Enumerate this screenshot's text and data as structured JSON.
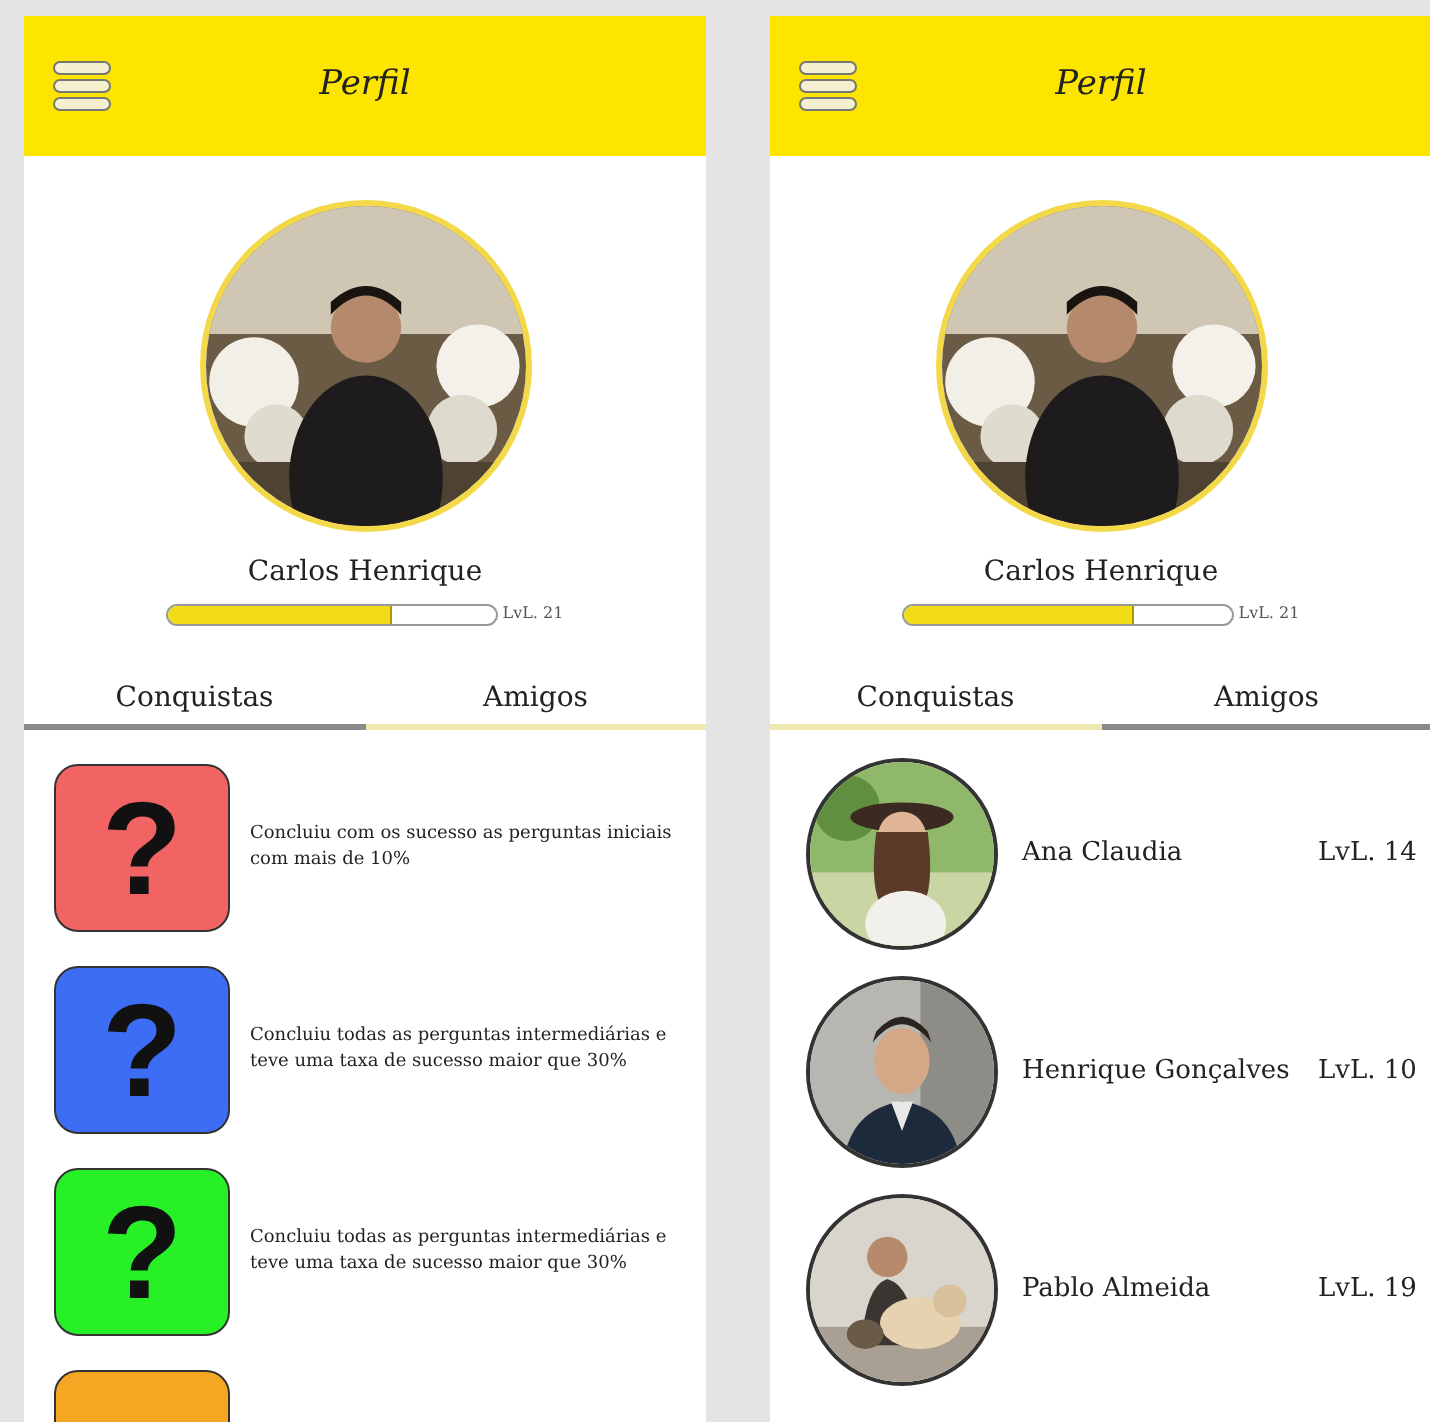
{
  "screens": [
    {
      "header": {
        "title": "Perfil"
      },
      "profile": {
        "name": "Carlos Henrique",
        "level": 0.68,
        "level_label": "LvL. 21"
      },
      "tabs": [
        {
          "label": "Conquistas",
          "selected": true
        },
        {
          "label": "Amigos",
          "selected": false
        }
      ],
      "achievements": [
        {
          "symbol": "?",
          "color": "#f26363",
          "description": "Concluiu com os sucesso as perguntas iniciais com mais de 10%"
        },
        {
          "symbol": "?",
          "color": "#3d6cf5",
          "description": "Concluiu todas as perguntas intermediárias e teve uma taxa de sucesso maior que 30%"
        },
        {
          "symbol": "?",
          "color": "#27f027",
          "description": "Concluiu todas as perguntas intermediárias e teve uma taxa de sucesso maior que 30%"
        },
        {
          "color": "#f5a623"
        }
      ]
    },
    {
      "header": {
        "title": "Perfil"
      },
      "profile": {
        "name": "Carlos Henrique",
        "level": 0.7,
        "level_label": "LvL. 21"
      },
      "tabs": [
        {
          "label": "Conquistas",
          "selected": false
        },
        {
          "label": "Amigos",
          "selected": true
        }
      ],
      "friends": [
        {
          "name": "Ana Claudia",
          "level_label": "LvL. 14"
        },
        {
          "name": "Henrique Gonçalves",
          "level_label": "LvL. 10"
        },
        {
          "name": "Pablo Almeida",
          "level_label": "LvL. 19"
        }
      ]
    }
  ]
}
